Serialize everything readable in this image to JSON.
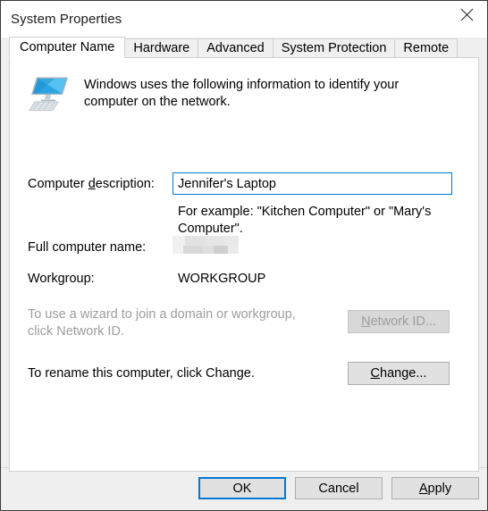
{
  "window": {
    "title": "System Properties",
    "close_icon": "close-icon"
  },
  "tabs": [
    {
      "label": "Computer Name",
      "active": true
    },
    {
      "label": "Hardware",
      "active": false
    },
    {
      "label": "Advanced",
      "active": false
    },
    {
      "label": "System Protection",
      "active": false
    },
    {
      "label": "Remote",
      "active": false
    }
  ],
  "panel": {
    "intro": "Windows uses the following information to identify your computer on the network.",
    "icon": "computer-monitor-icon",
    "description": {
      "label_before": "Computer ",
      "label_accel": "d",
      "label_after": "escription:",
      "value": "Jennifer's Laptop",
      "placeholder": "",
      "hint": "For example: \"Kitchen Computer\" or \"Mary's Computer\"."
    },
    "full_computer_name": {
      "label": "Full computer name:",
      "value": ""
    },
    "workgroup": {
      "label": "Workgroup:",
      "value": "WORKGROUP"
    },
    "network_id": {
      "text": "To use a wizard to join a domain or workgroup, click Network ID.",
      "button_accel": "N",
      "button_rest": "etwork ID...",
      "disabled": true
    },
    "rename": {
      "text": "To rename this computer, click Change.",
      "button_accel": "C",
      "button_rest": "hange...",
      "disabled": false
    }
  },
  "footer": {
    "ok": "OK",
    "cancel": "Cancel",
    "apply_accel": "A",
    "apply_rest": "pply"
  },
  "colors": {
    "accent": "#0078d7",
    "button_face": "#e1e1e1",
    "disabled_text": "#9d9d9d",
    "dialog_bg": "#efefef"
  }
}
